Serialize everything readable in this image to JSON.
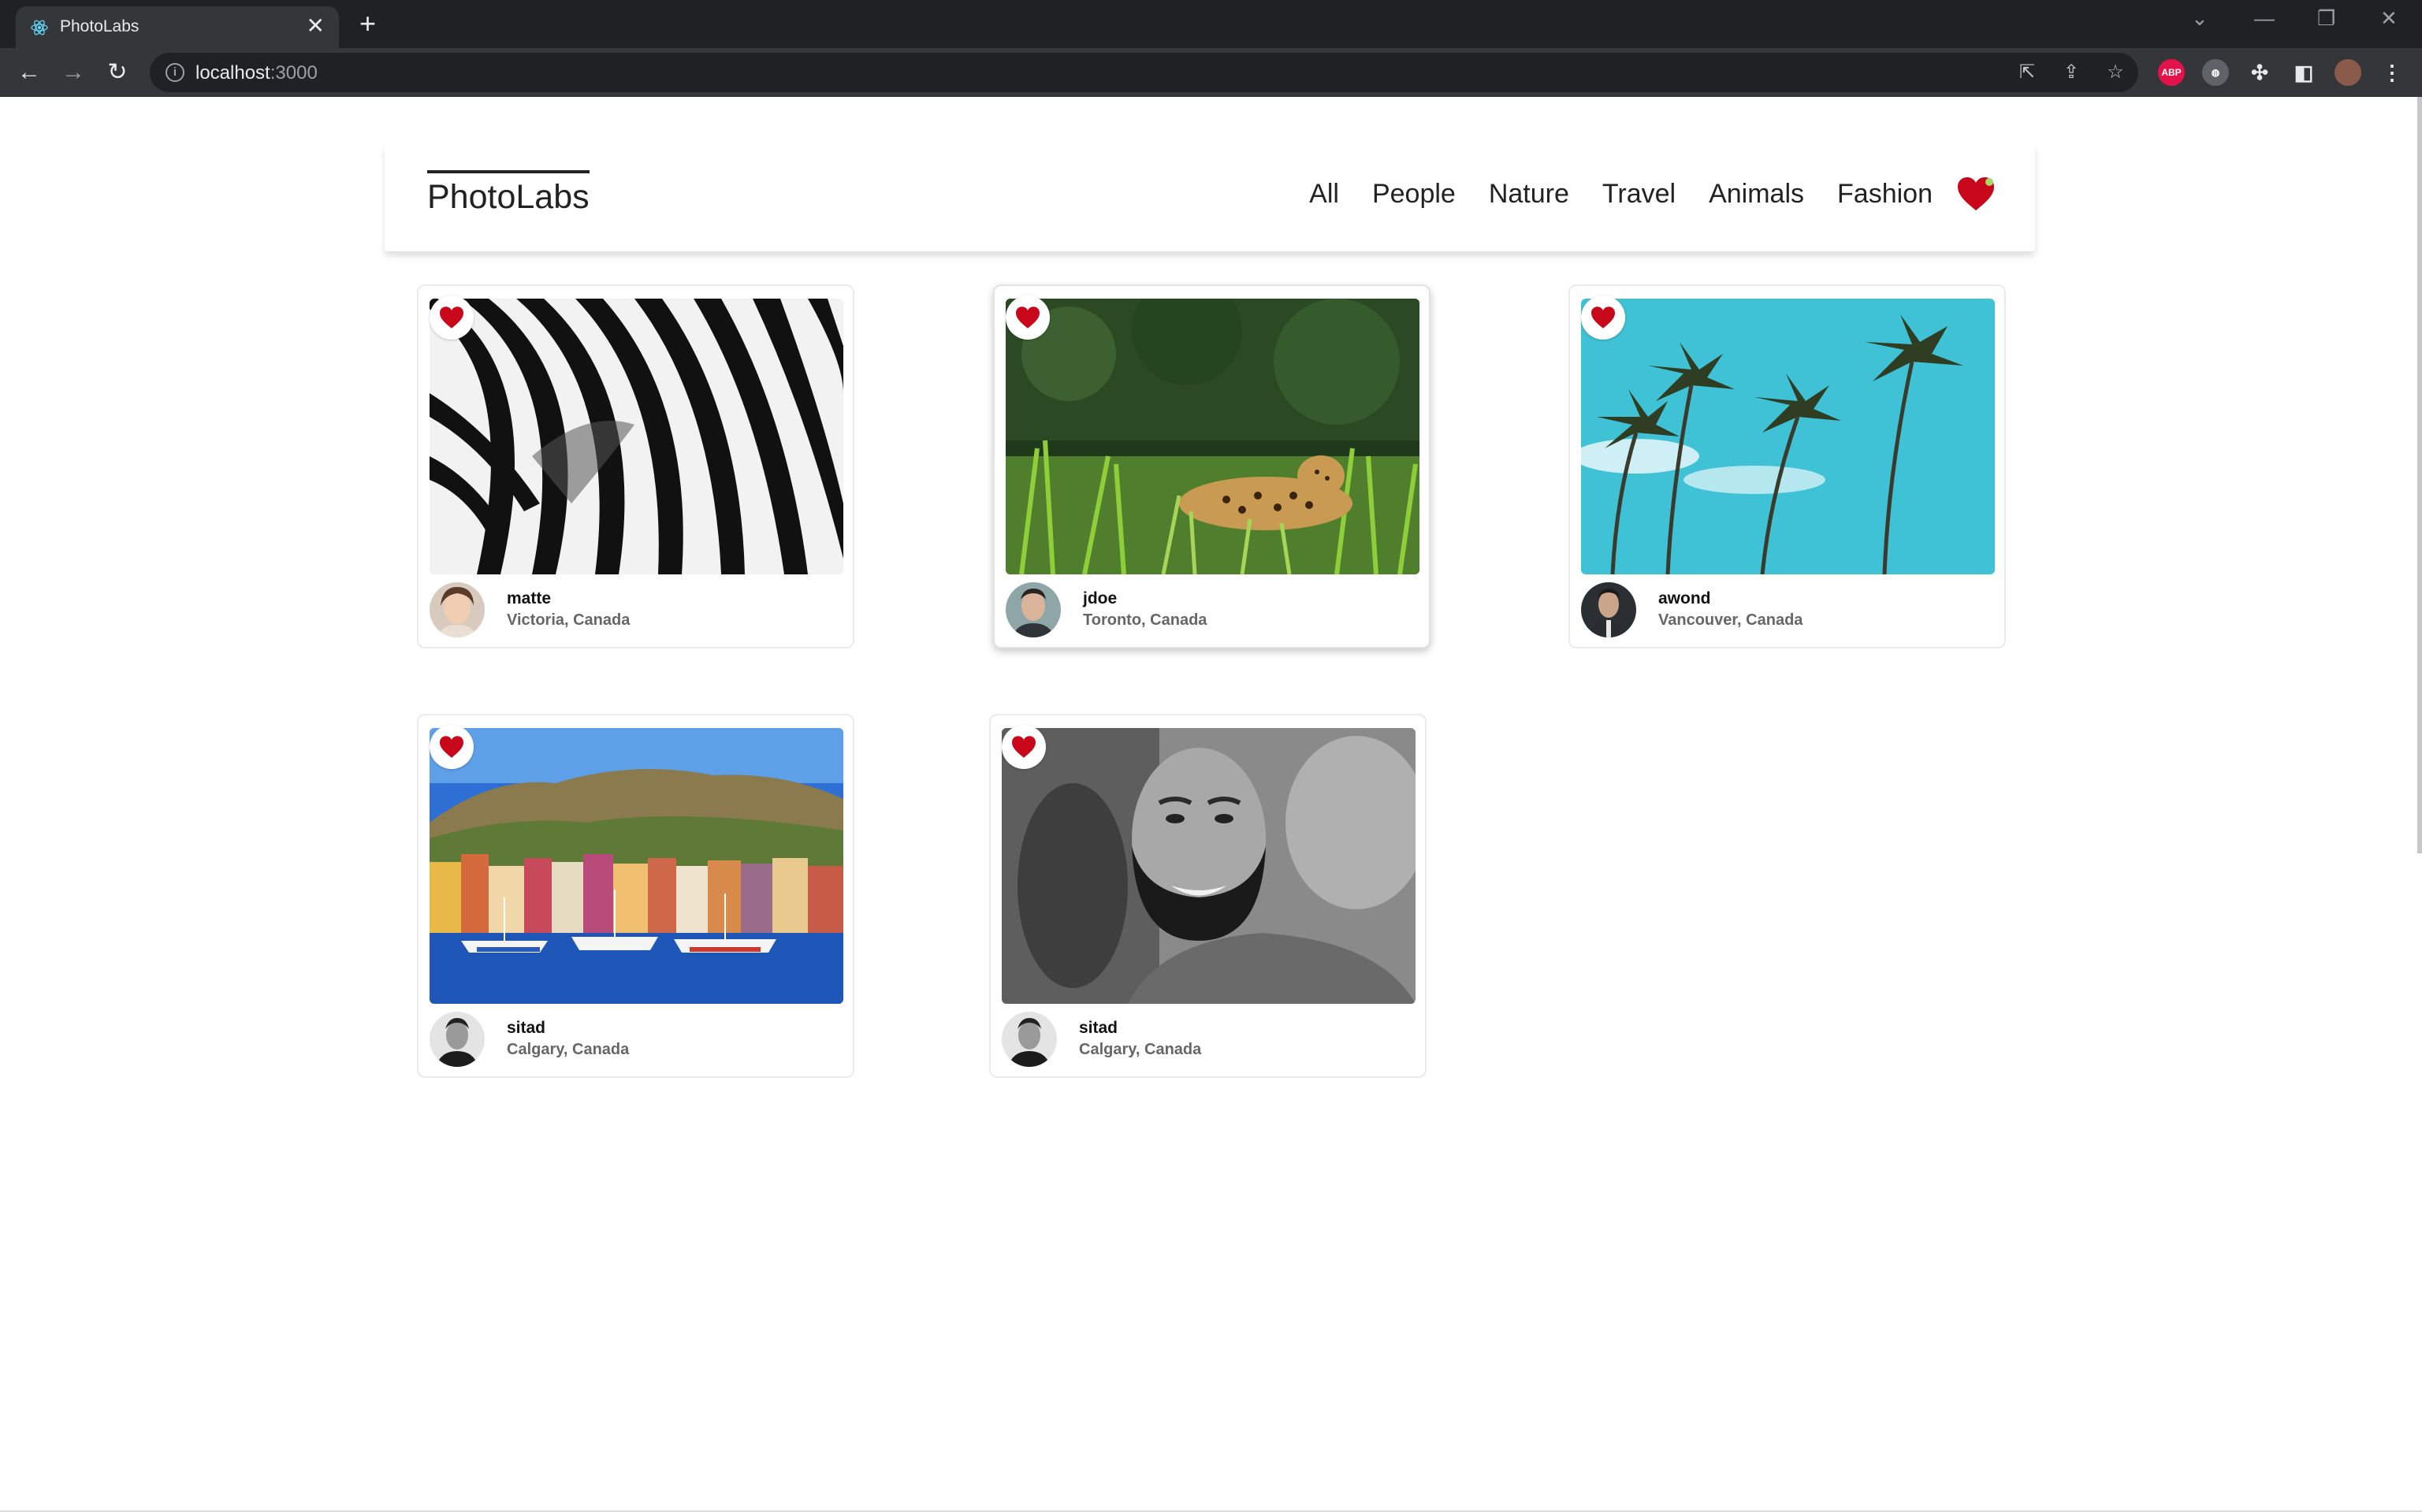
{
  "browser": {
    "tab_title": "PhotoLabs",
    "url_host": "localhost",
    "url_port": ":3000",
    "ext_abp_label": "ABP"
  },
  "app": {
    "logo": "PhotoLabs",
    "topics": [
      "All",
      "People",
      "Nature",
      "Travel",
      "Animals",
      "Fashion"
    ],
    "accent_color": "#c8071b"
  },
  "photos": [
    {
      "username": "matte",
      "location": "Victoria, Canada"
    },
    {
      "username": "jdoe",
      "location": "Toronto, Canada"
    },
    {
      "username": "awond",
      "location": "Vancouver, Canada"
    },
    {
      "username": "sitad",
      "location": "Calgary, Canada"
    },
    {
      "username": "sitad",
      "location": "Calgary, Canada"
    }
  ]
}
